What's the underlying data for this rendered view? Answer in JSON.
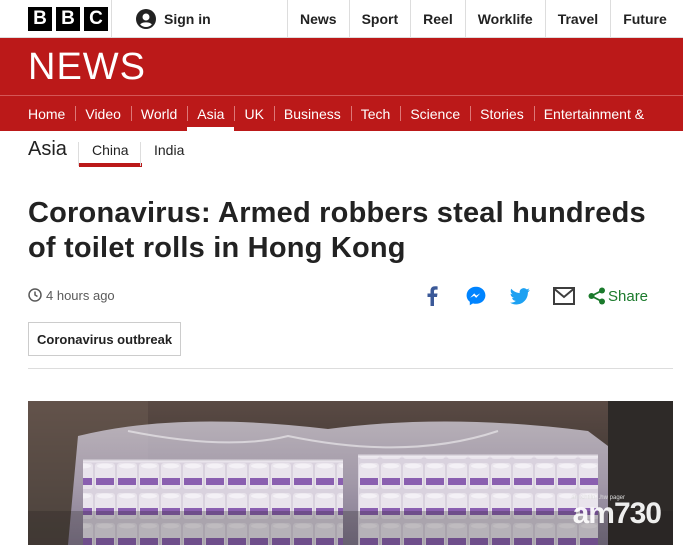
{
  "brand": {
    "letters": [
      "B",
      "B",
      "C"
    ],
    "section_wordmark": "NEWS"
  },
  "account": {
    "signin_label": "Sign in"
  },
  "top_nav": [
    "News",
    "Sport",
    "Reel",
    "Worklife",
    "Travel",
    "Future"
  ],
  "section_nav": {
    "items": [
      "Home",
      "Video",
      "World",
      "Asia",
      "UK",
      "Business",
      "Tech",
      "Science",
      "Stories",
      "Entertainment &"
    ],
    "active": "Asia"
  },
  "sub_nav": {
    "title": "Asia",
    "items": [
      "China",
      "India"
    ],
    "active": "China"
  },
  "article": {
    "headline": "Coronavirus: Armed robbers steal hundreds of toilet rolls in Hong Kong",
    "timestamp": "4 hours ago",
    "share_label": "Share",
    "share_icons": [
      "facebook-icon",
      "messenger-icon",
      "twitter-icon",
      "email-icon",
      "share-icon"
    ],
    "tag": "Coronavirus outbreak"
  },
  "image": {
    "watermark": "am730",
    "watermark_small": "am.chtiln...hw pager"
  },
  "colors": {
    "brand_red": "#bb1919",
    "share_green": "#1b7a2c",
    "facebook_blue": "#3b5998",
    "messenger_blue": "#0084ff",
    "twitter_blue": "#1da1f2"
  }
}
